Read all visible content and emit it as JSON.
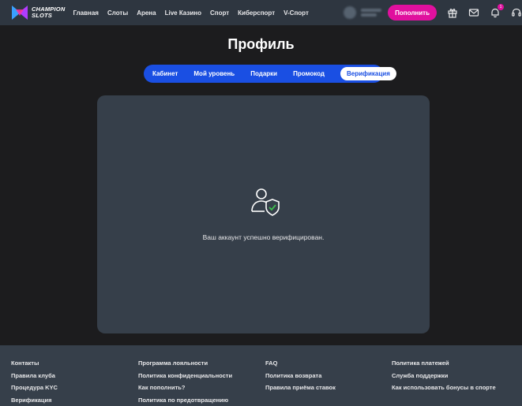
{
  "header": {
    "logo_line1": "CHAMPION",
    "logo_line2": "SLOTS",
    "nav": [
      "Главная",
      "Слоты",
      "Арена",
      "Live Казино",
      "Спорт",
      "Киберспорт",
      "V-Спорт"
    ],
    "deposit_label": "Пополнить",
    "notification_count": "1",
    "icons": [
      "gift-icon",
      "mail-icon",
      "bell-icon",
      "headset-icon"
    ]
  },
  "page": {
    "title": "Профиль"
  },
  "tabs": [
    {
      "label": "Кабинет",
      "active": false
    },
    {
      "label": "Мой уровень",
      "active": false
    },
    {
      "label": "Подарки",
      "active": false
    },
    {
      "label": "Промокод",
      "active": false
    },
    {
      "label": "Верификация",
      "active": true
    }
  ],
  "verification": {
    "message": "Ваш аккаунт успешно верифицирован."
  },
  "footer": {
    "columns": [
      [
        "Контакты",
        "Правила клуба",
        "Процедура KYC",
        "Верификация"
      ],
      [
        "Программа лояльности",
        "Политика конфиденциальности",
        "Как пополнить?",
        "Политика по предотвращению"
      ],
      [
        "FAQ",
        "Политика возврата",
        "Правила приёма ставок"
      ],
      [
        "Политика платежей",
        "Служба поддержки",
        "Как использовать бонусы в спорте"
      ]
    ]
  },
  "colors": {
    "accent_blue": "#1a4fe3",
    "accent_pink": "#e0109e",
    "header_bg": "#2e3640",
    "panel_bg": "#363f4a",
    "check_green": "#3fbf4f"
  }
}
